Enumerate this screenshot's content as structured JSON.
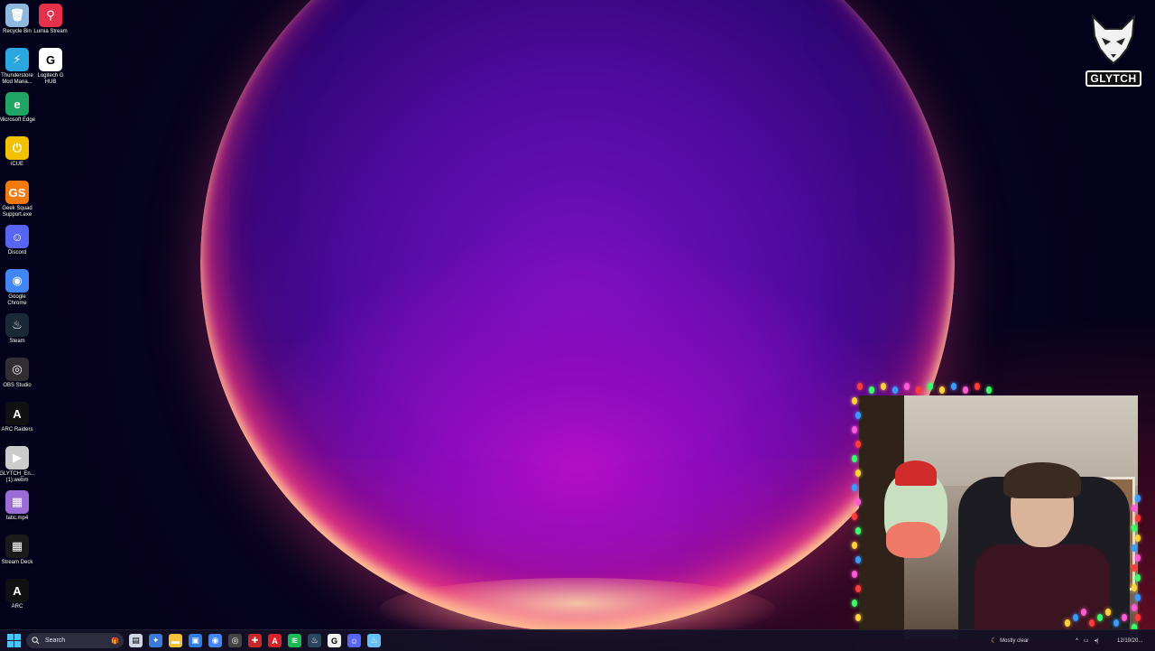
{
  "desktop": {
    "icons": [
      {
        "id": "recycle-bin",
        "label": "Recycle Bin",
        "icon": "recycle-bin-icon",
        "color": "#8fb8de"
      },
      {
        "id": "lumia-stream",
        "label": "Lumia Stream",
        "icon": "lumia-stream-icon",
        "color": "#e5324a"
      },
      {
        "id": "thunderstore",
        "label": "Thunderstore Mod Mana...",
        "icon": "thunderstore-icon",
        "color": "#2aa6e0"
      },
      {
        "id": "logitech-ghub",
        "label": "Logitech G HUB",
        "icon": "logitech-g-icon",
        "color": "#ffffff"
      },
      {
        "id": "microsoft-edge",
        "label": "Microsoft Edge",
        "icon": "edge-icon",
        "color": "#1fa463"
      },
      {
        "id": "icue",
        "label": "iCUE",
        "icon": "icue-icon",
        "color": "#f2c200"
      },
      {
        "id": "geek-squad",
        "label": "Geek Squad Support.exe",
        "icon": "geek-squad-icon",
        "color": "#f07a10"
      },
      {
        "id": "discord",
        "label": "Discord",
        "icon": "discord-icon",
        "color": "#5865f2"
      },
      {
        "id": "google-chrome",
        "label": "Google Chrome",
        "icon": "chrome-icon",
        "color": "#4285f4"
      },
      {
        "id": "steam",
        "label": "Steam",
        "icon": "steam-icon",
        "color": "#1b2838"
      },
      {
        "id": "obs-studio",
        "label": "OBS Studio",
        "icon": "obs-icon",
        "color": "#302e31"
      },
      {
        "id": "arc-raiders",
        "label": "ARC Raiders",
        "icon": "arc-raiders-icon",
        "color": "#111111"
      },
      {
        "id": "glytch-webm",
        "label": "GLYTCH_En... (1).webm",
        "icon": "fox-video-icon",
        "color": "#cccccc"
      },
      {
        "id": "static-mp4",
        "label": "tatic.mp4",
        "icon": "video-file-icon",
        "color": "#9b6bd6"
      },
      {
        "id": "stream-deck",
        "label": "Stream Deck",
        "icon": "stream-deck-icon",
        "color": "#1a1a1a"
      },
      {
        "id": "arc",
        "label": "ARC",
        "icon": "arc-icon",
        "color": "#111111"
      }
    ]
  },
  "brand": {
    "text": "GLYTCH",
    "icon": "fox-logo-icon"
  },
  "webcam": {
    "icon": "webcam-feed"
  },
  "taskbar": {
    "start_icon": "windows-start-icon",
    "search_placeholder": "Search",
    "apps": [
      {
        "id": "task-view",
        "icon": "task-view-icon",
        "color": "#cfd6e6"
      },
      {
        "id": "copilot",
        "icon": "copilot-icon",
        "color": "#3a7bd5"
      },
      {
        "id": "file-explorer",
        "icon": "folder-icon",
        "color": "#f3c13a"
      },
      {
        "id": "store",
        "icon": "store-icon",
        "color": "#2f7de1"
      },
      {
        "id": "chrome",
        "icon": "chrome-icon",
        "color": "#4285f4"
      },
      {
        "id": "obs",
        "icon": "obs-icon",
        "color": "#444444"
      },
      {
        "id": "tool-red",
        "icon": "red-app-icon",
        "color": "#c82828"
      },
      {
        "id": "acrobat",
        "icon": "acrobat-icon",
        "color": "#d8232a"
      },
      {
        "id": "spotify",
        "icon": "spotify-icon",
        "color": "#1db954"
      },
      {
        "id": "steam-1",
        "icon": "steam-icon",
        "color": "#2a475e"
      },
      {
        "id": "logitech",
        "icon": "logitech-g-icon",
        "color": "#eeeeee"
      },
      {
        "id": "discord",
        "icon": "discord-icon",
        "color": "#5865f2"
      },
      {
        "id": "steam-2",
        "icon": "steam-icon",
        "color": "#66c0f4"
      }
    ],
    "weather": "Mostly clear",
    "date": "12/19/20..."
  }
}
